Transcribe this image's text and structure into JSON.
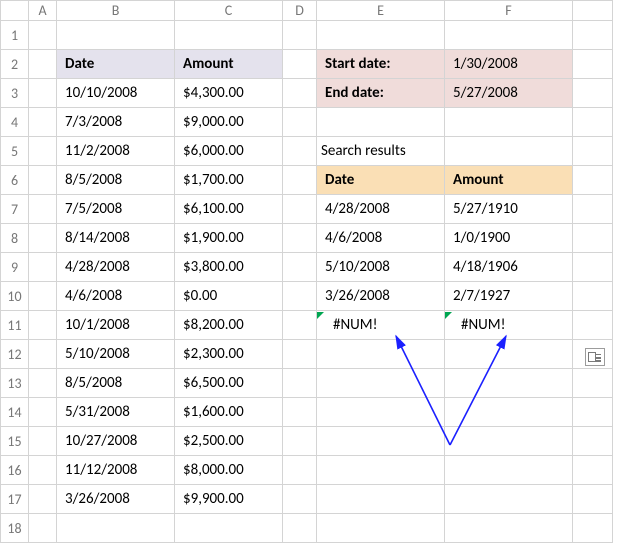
{
  "columns": [
    "A",
    "B",
    "C",
    "D",
    "E",
    "F"
  ],
  "row_count": 18,
  "main_table": {
    "header": {
      "date": "Date",
      "amount": "Amount"
    },
    "rows": [
      {
        "date": "10/10/2008",
        "amount": "$4,300.00"
      },
      {
        "date": "7/3/2008",
        "amount": "$9,000.00"
      },
      {
        "date": "11/2/2008",
        "amount": "$6,000.00"
      },
      {
        "date": "8/5/2008",
        "amount": "$1,700.00"
      },
      {
        "date": "7/5/2008",
        "amount": "$6,100.00"
      },
      {
        "date": "8/14/2008",
        "amount": "$1,900.00"
      },
      {
        "date": "4/28/2008",
        "amount": "$3,800.00"
      },
      {
        "date": "4/6/2008",
        "amount": "$0.00"
      },
      {
        "date": "10/1/2008",
        "amount": "$8,200.00"
      },
      {
        "date": "5/10/2008",
        "amount": "$2,300.00"
      },
      {
        "date": "8/5/2008",
        "amount": "$6,500.00"
      },
      {
        "date": "5/31/2008",
        "amount": "$1,600.00"
      },
      {
        "date": "10/27/2008",
        "amount": "$2,500.00"
      },
      {
        "date": "11/12/2008",
        "amount": "$8,000.00"
      },
      {
        "date": "3/26/2008",
        "amount": "$9,900.00"
      }
    ]
  },
  "params": {
    "start_label": "Start date:",
    "start_value": "1/30/2008",
    "end_label": "End date:",
    "end_value": "5/27/2008"
  },
  "search_label": "Search results",
  "results": {
    "header": {
      "date": "Date",
      "amount": "Amount"
    },
    "rows": [
      {
        "date": "4/28/2008",
        "amount": "5/27/1910"
      },
      {
        "date": "4/6/2008",
        "amount": "1/0/1900"
      },
      {
        "date": "5/10/2008",
        "amount": "4/18/1906"
      },
      {
        "date": "3/26/2008",
        "amount": "2/7/1927"
      },
      {
        "date": "#NUM!",
        "amount": "#NUM!"
      }
    ]
  }
}
